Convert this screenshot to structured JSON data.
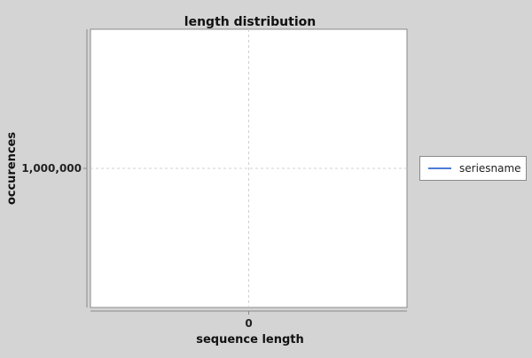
{
  "chart_data": {
    "type": "line",
    "title": "length distribution",
    "xlabel": "sequence length",
    "ylabel": "occurences",
    "x_ticks": [
      {
        "value": 0,
        "label": "0"
      }
    ],
    "y_ticks": [
      {
        "value": 1000000,
        "label": "1,000,000"
      }
    ],
    "xlim": [
      -1,
      1
    ],
    "ylim": [
      0,
      2000000
    ],
    "grid": true,
    "legend_position": "right",
    "series": [
      {
        "name": "seriesname",
        "color": "#4d7ad6",
        "points": []
      }
    ]
  }
}
